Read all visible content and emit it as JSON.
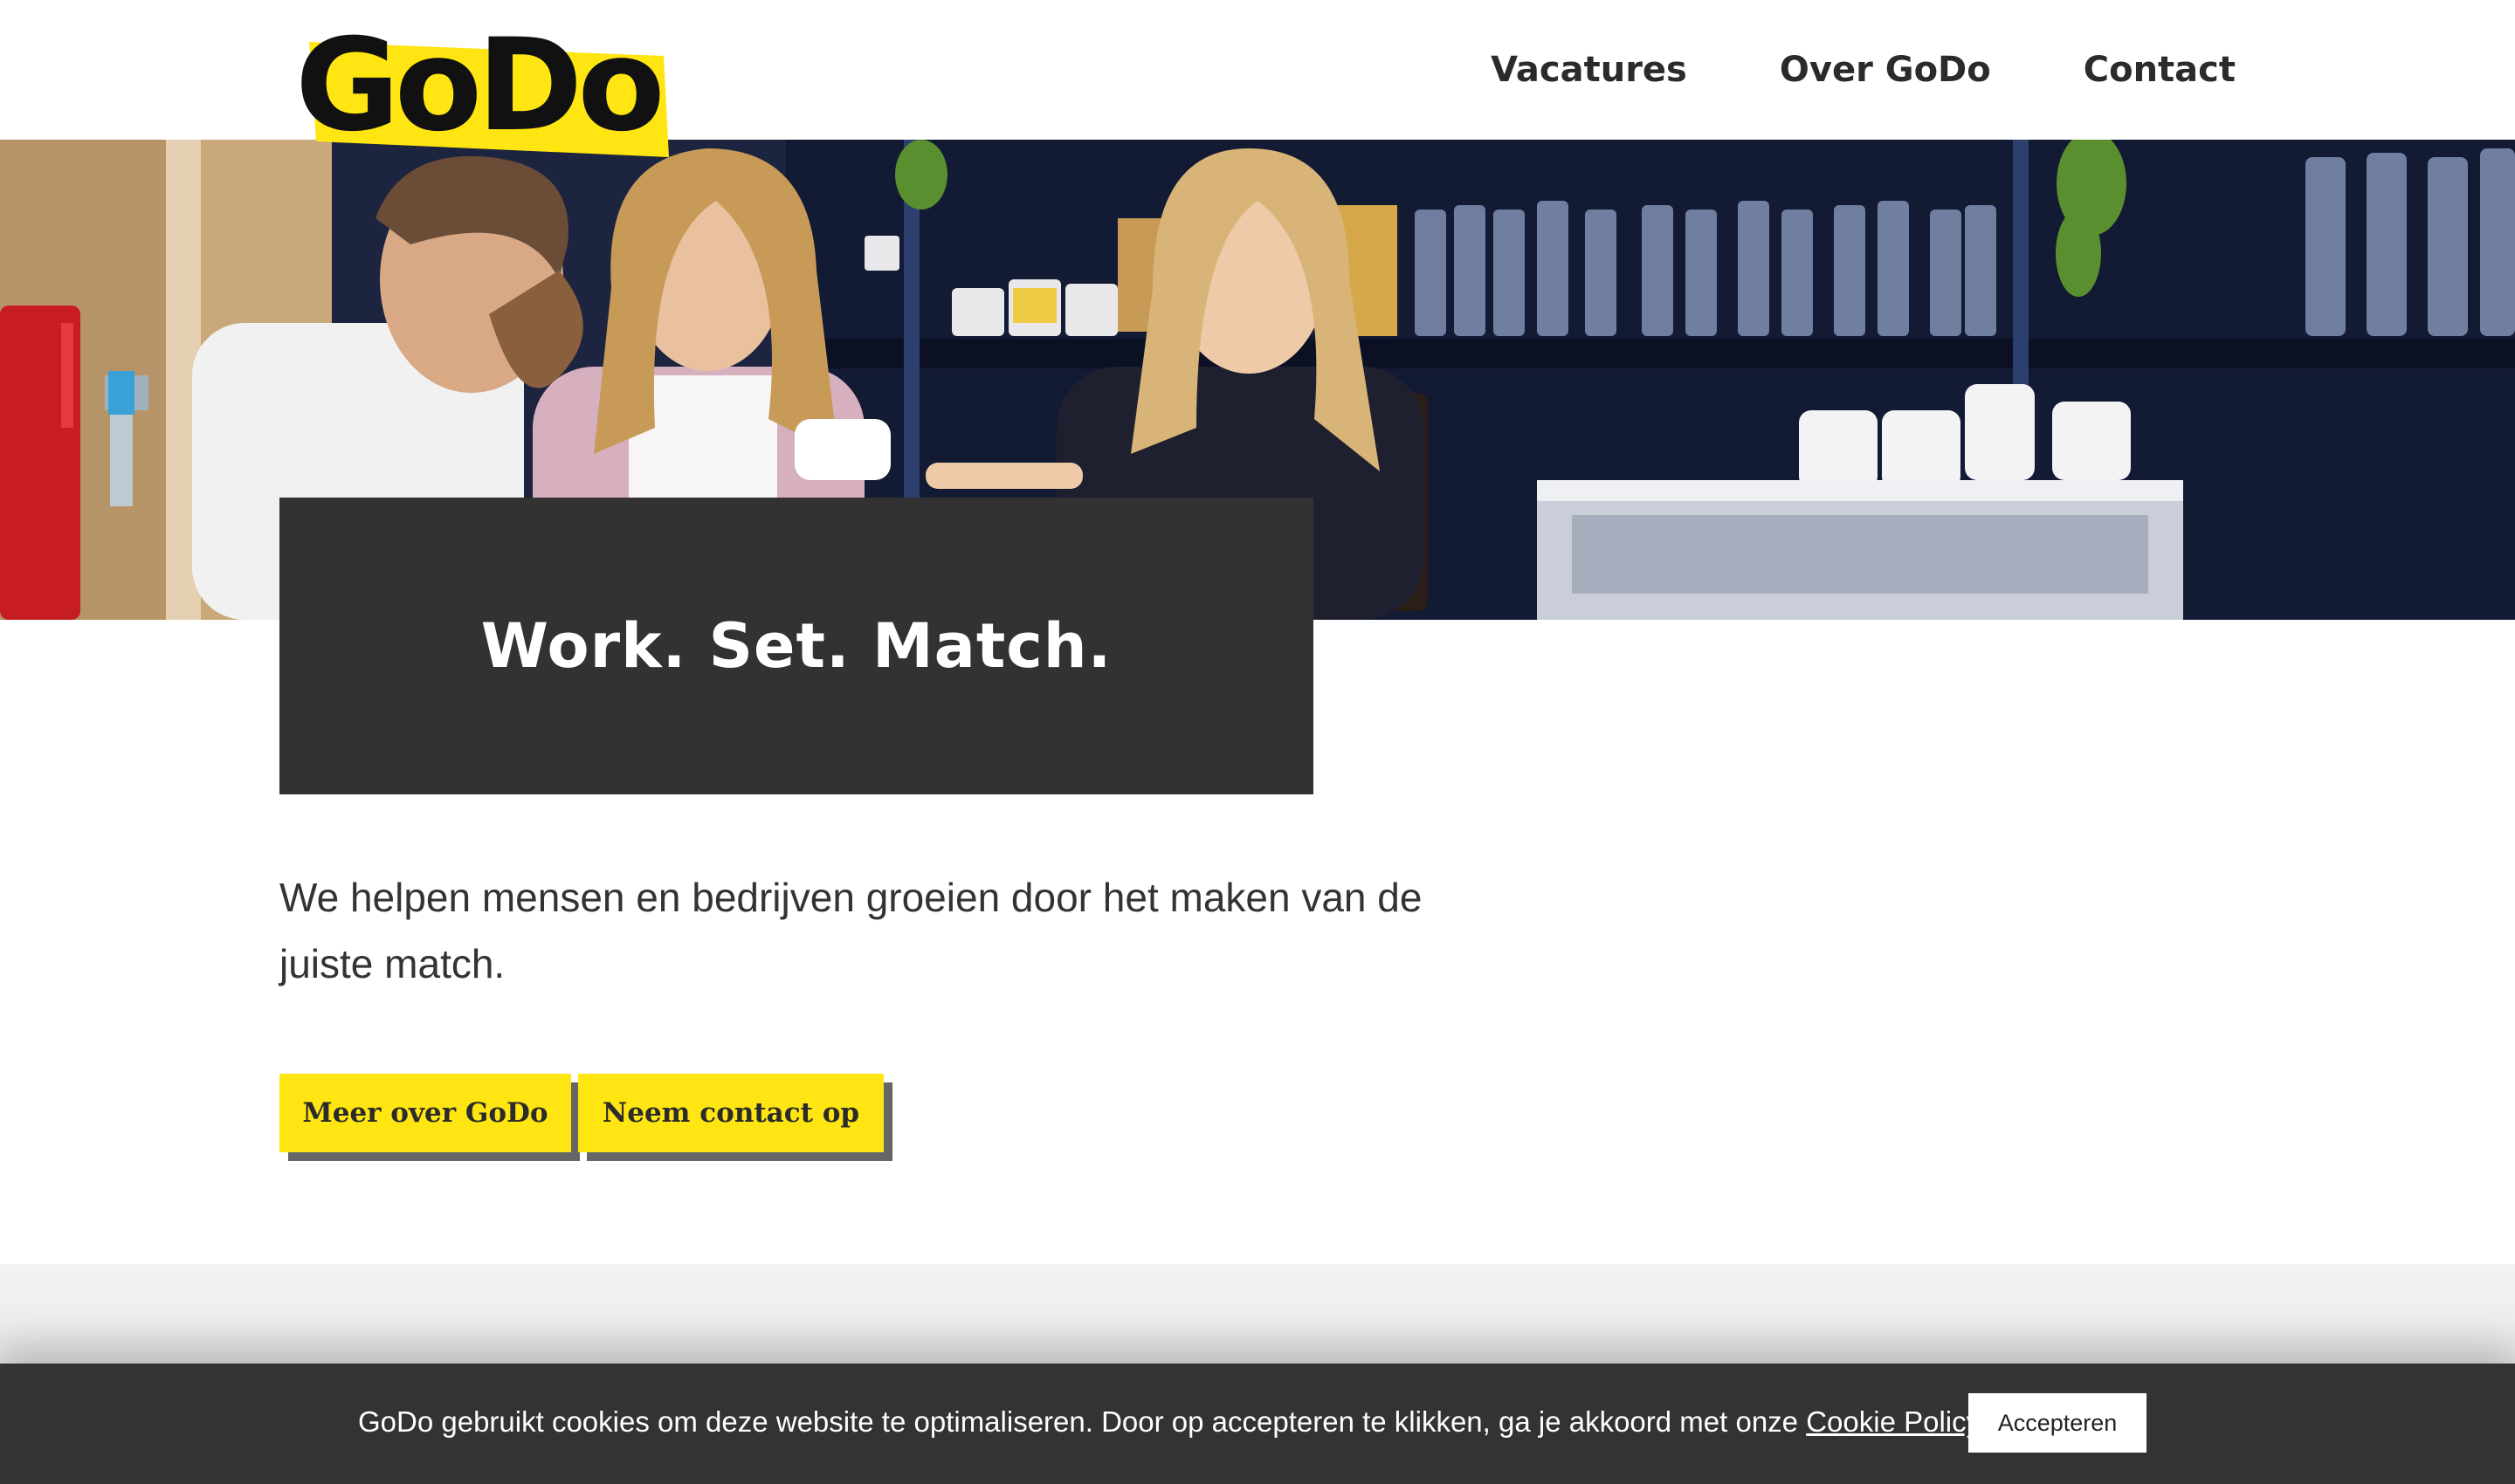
{
  "brand": {
    "logo_text": "GoDo",
    "accent_color": "#ffe511",
    "dark_color": "#323232"
  },
  "nav": {
    "items": [
      {
        "label": "Vacatures"
      },
      {
        "label": "Over GoDo"
      },
      {
        "label": "Contact"
      }
    ]
  },
  "hero": {
    "title": "Work. Set. Match.",
    "intro": "We helpen mensen en bedrijven groeien door het maken van de juiste match.",
    "buttons": [
      {
        "label": "Meer over GoDo"
      },
      {
        "label": "Neem contact op"
      }
    ]
  },
  "cookie": {
    "text": "GoDo gebruikt cookies om deze website te optimaliseren. Door op accepteren te klikken, ga je akkoord met onze ",
    "link_label": "Cookie Policy",
    "accept_label": "Accepteren"
  }
}
